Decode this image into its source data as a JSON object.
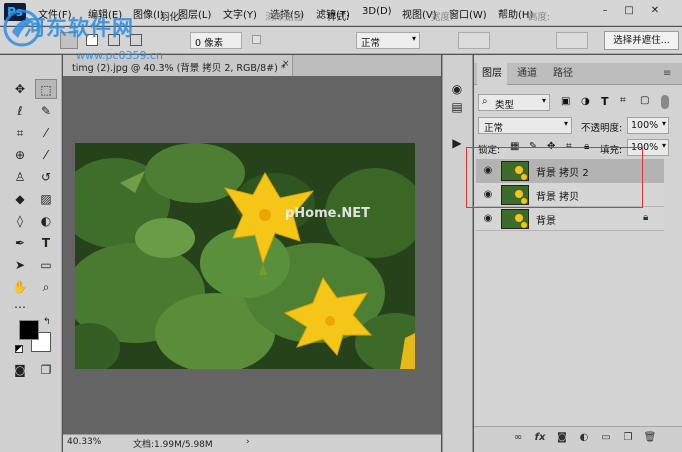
{
  "app": {
    "logo": "Ps"
  },
  "menu": [
    "文件(F)",
    "编辑(E)",
    "图像(I)",
    "图层(L)",
    "文字(Y)",
    "选择(S)",
    "滤镜(T)",
    "3D(D)",
    "视图(V)",
    "窗口(W)",
    "帮助(H)"
  ],
  "window_controls": {
    "minimize": "–",
    "maximize": "□",
    "close": "✕"
  },
  "options": {
    "feather_label": "羽化:",
    "feather_value": "0 像素",
    "antialias_label": "消除锯齿",
    "style_label": "样式:",
    "style_value": "正常",
    "width_label": "宽度:",
    "height_label": "高度:",
    "select_mask_button": "选择并遮住..."
  },
  "document": {
    "tab_title": "timg (2).jpg @ 40.3% (背景 拷贝 2, RGB/8#) *",
    "close": "×",
    "zoom": "40.33%",
    "doc_size": "文档:1.99M/5.98M"
  },
  "panel": {
    "tabs": [
      "图层",
      "通道",
      "路径"
    ],
    "active_tab": "图层",
    "filter_kind": "类型",
    "blend_mode": "正常",
    "opacity_label": "不透明度:",
    "opacity_value": "100%",
    "lock_label": "锁定:",
    "fill_label": "填充:",
    "fill_value": "100%",
    "layers": [
      {
        "name": "背景 拷贝 2",
        "visible": true,
        "selected": true,
        "locked": false
      },
      {
        "name": "背景 拷贝",
        "visible": true,
        "selected": false,
        "locked": false
      },
      {
        "name": "背景",
        "visible": true,
        "selected": false,
        "locked": true
      }
    ]
  },
  "watermarks": {
    "site_name": "河东软件网",
    "site_url": "www.pc0359.cn",
    "image_mark": "pHome.NET"
  },
  "colors": {
    "accent": "#31a8ff",
    "highlight": "#e0343a",
    "watermark": "#2d8ee0"
  }
}
